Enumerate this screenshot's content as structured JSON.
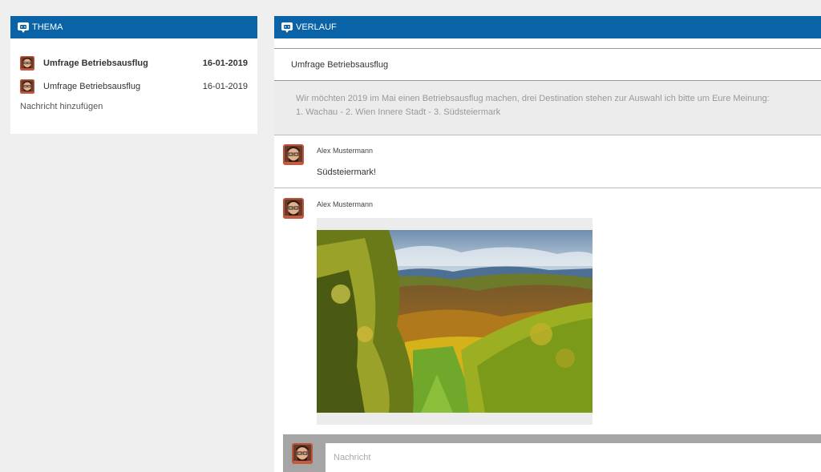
{
  "thema": {
    "header": "THEMA",
    "topics": [
      {
        "title": "Umfrage Betriebsausflug",
        "date": "16-01-2019"
      },
      {
        "title": "Umfrage Betriebsausflug",
        "date": "16-01-2019"
      }
    ],
    "add_message": "Nachricht hinzufügen"
  },
  "verlauf": {
    "header": "VERLAUF",
    "subject": "Umfrage Betriebsausflug",
    "description_line1": "Wir möchten 2019 im Mai einen Betriebsausflug machen, drei Destination stehen zur Auswahl ich bitte um Eure Meinung:",
    "description_line2": "1. Wachau  -  2. Wien Innere Stadt  -  3. Südsteiermark",
    "messages": [
      {
        "author": "Alex Mustermann",
        "text": "Südsteiermark!"
      },
      {
        "author": "Alex Mustermann",
        "image": "vineyard-landscape-photo"
      }
    ],
    "compose_placeholder": "Nachricht"
  },
  "icons": {
    "header": "chat-bubble-icon",
    "avatar": "user-avatar"
  },
  "colors": {
    "header_blue": "#0a63a7",
    "background": "#efefef"
  }
}
